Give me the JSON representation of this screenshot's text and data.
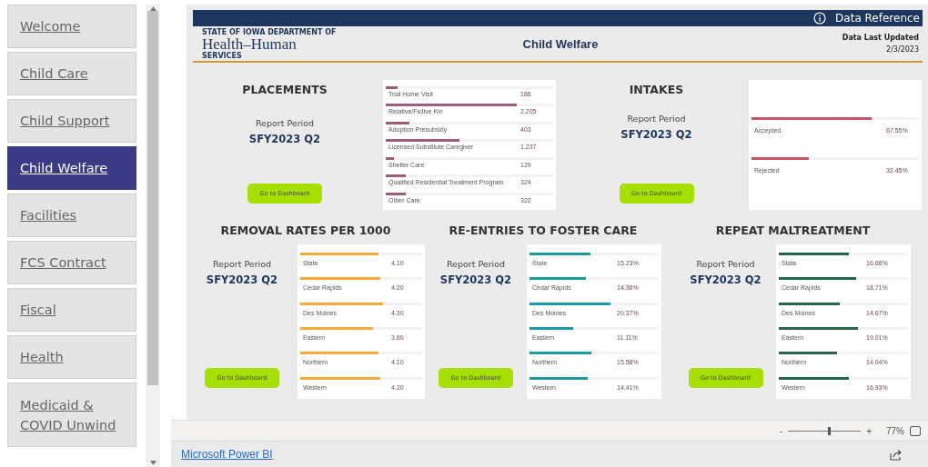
{
  "sidebar": {
    "items": [
      {
        "label": "Welcome",
        "selected": false
      },
      {
        "label": "Child Care",
        "selected": false
      },
      {
        "label": "Child Support",
        "selected": false
      },
      {
        "label": "Child Welfare",
        "selected": true
      },
      {
        "label": "Facilities",
        "selected": false
      },
      {
        "label": "FCS Contract",
        "selected": false
      },
      {
        "label": "Fiscal",
        "selected": false
      },
      {
        "label": "Health",
        "selected": false
      },
      {
        "label": "Medicaid & COVID Unwind",
        "selected": false
      }
    ]
  },
  "header": {
    "info_label": "Data Reference",
    "logo_top": "STATE OF IOWA DEPARTMENT OF",
    "logo_main": "Health–Human",
    "logo_bottom": "SERVICES",
    "title": "Child Welfare",
    "updated_label": "Data Last Updated",
    "updated_date": "2/3/2023"
  },
  "top_row": [
    {
      "title": "PLACEMENTS",
      "report_label": "Report Period",
      "period": "SFY2023 Q2",
      "button": "Go to Dashboard",
      "color": "#9c5a7c",
      "rows": [
        {
          "label": "Trial Home Visit",
          "value": "186",
          "level": 0.07
        },
        {
          "label": "Relative/Fictive Kin",
          "value": "2,205",
          "level": 0.78
        },
        {
          "label": "Adoption Presubsidy",
          "value": "403",
          "level": 0.14
        },
        {
          "label": "Licensed Substitute Caregiver",
          "value": "1,237",
          "level": 0.44
        },
        {
          "label": "Shelter Care",
          "value": "129",
          "level": 0.05
        },
        {
          "label": "Qualified Residential Treatment Program",
          "value": "324",
          "level": 0.12
        },
        {
          "label": "Other Care",
          "value": "322",
          "level": 0.12
        }
      ]
    },
    {
      "title": "INTAKES",
      "report_label": "Report Period",
      "period": "SFY2023 Q2",
      "button": "Go to Dashboard",
      "color": "#c05668",
      "rows": [
        {
          "label": "Accepted",
          "value": "67.55%",
          "level": 0.72
        },
        {
          "label": "Rejected",
          "value": "32.45%",
          "level": 0.34
        }
      ]
    }
  ],
  "bottom_row": [
    {
      "title": "REMOVAL RATES PER 1000",
      "report_label": "Report Period",
      "period": "SFY2023 Q2",
      "button": "Go to Dashboard",
      "color": "#f7a93b",
      "rows": [
        {
          "label": "State",
          "value": "4.10",
          "level": 0.64
        },
        {
          "label": "Cedar Rapids",
          "value": "4.20",
          "level": 0.66
        },
        {
          "label": "Des Moines",
          "value": "4.30",
          "level": 0.68
        },
        {
          "label": "Eastern",
          "value": "3.80",
          "level": 0.6
        },
        {
          "label": "Northern",
          "value": "4.10",
          "level": 0.64
        },
        {
          "label": "Western",
          "value": "4.20",
          "level": 0.66
        }
      ]
    },
    {
      "title": "RE-ENTRIES TO FOSTER CARE",
      "report_label": "Report Period",
      "period": "SFY2023 Q2",
      "button": "Go to Dashboard",
      "color": "#1a9aa3",
      "rows": [
        {
          "label": "State",
          "value": "15.23%",
          "level": 0.47
        },
        {
          "label": "Cedar Rapids",
          "value": "14.36%",
          "level": 0.44
        },
        {
          "label": "Des Moines",
          "value": "20.37%",
          "level": 0.63
        },
        {
          "label": "Eastern",
          "value": "11.11%",
          "level": 0.34
        },
        {
          "label": "Northern",
          "value": "15.58%",
          "level": 0.48
        },
        {
          "label": "Western",
          "value": "14.41%",
          "level": 0.45
        }
      ]
    },
    {
      "title": "REPEAT MALTREATMENT",
      "report_label": "Report Period",
      "period": "SFY2023 Q2",
      "button": "Go to Dashboard",
      "color": "#23664a",
      "rows": [
        {
          "label": "State",
          "value": "16.68%",
          "level": 0.54
        },
        {
          "label": "Cedar Rapids",
          "value": "18.71%",
          "level": 0.6
        },
        {
          "label": "Des Moines",
          "value": "14.67%",
          "level": 0.47
        },
        {
          "label": "Eastern",
          "value": "19.01%",
          "level": 0.61
        },
        {
          "label": "Northern",
          "value": "14.04%",
          "level": 0.45
        },
        {
          "label": "Western",
          "value": "16.93%",
          "level": 0.54
        }
      ]
    }
  ],
  "footer": {
    "zoom_minus": "-",
    "zoom_plus": "+",
    "zoom": "77%",
    "level": 0.55,
    "link": "Microsoft Power BI"
  }
}
